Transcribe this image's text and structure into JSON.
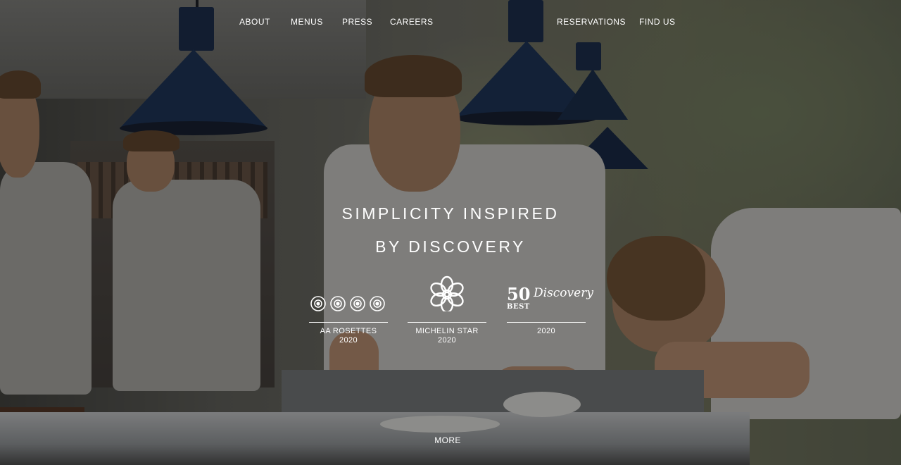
{
  "nav": {
    "left": [
      "ABOUT",
      "MENUS",
      "PRESS",
      "CAREERS"
    ],
    "right": [
      "RESERVATIONS",
      "FIND US"
    ]
  },
  "hero": {
    "line1": "SIMPLICITY INSPIRED",
    "line2": "BY DISCOVERY"
  },
  "awards": [
    {
      "icon": "rosette-icon",
      "line1": "AA ROSETTES",
      "line2": "2020"
    },
    {
      "icon": "michelin-star-icon",
      "line1": "MICHELIN STAR",
      "line2": "2020"
    },
    {
      "icon": "50-best-discovery-logo",
      "logo_text_1": "50",
      "logo_text_2": "BEST",
      "logo_text_3": "Discovery",
      "line1": "2020"
    }
  ],
  "more_label": "MORE",
  "colors": {
    "text": "#ffffff",
    "lamp": "#1f3354",
    "overlay": "rgba(0,0,0,0.42)"
  }
}
